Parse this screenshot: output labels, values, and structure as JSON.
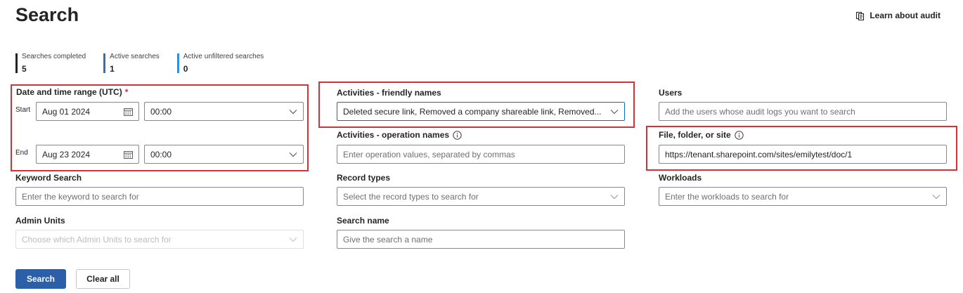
{
  "header": {
    "title": "Search",
    "learn_link": "Learn about audit",
    "learn_icon": "book-icon"
  },
  "stats": [
    {
      "label": "Searches completed",
      "value": "5",
      "color": "#242424"
    },
    {
      "label": "Active searches",
      "value": "1",
      "color": "#3a6ea8"
    },
    {
      "label": "Active unfiltered searches",
      "value": "0",
      "color": "#2f8fe0"
    }
  ],
  "date_range": {
    "label": "Date and time range (UTC)",
    "required_mark": "*",
    "start_label": "Start",
    "start_date": "Aug 01 2024",
    "start_time": "00:00",
    "end_label": "End",
    "end_date": "Aug 23 2024",
    "end_time": "00:00"
  },
  "keyword_search": {
    "label": "Keyword Search",
    "placeholder": "Enter the keyword to search for"
  },
  "admin_units": {
    "label": "Admin Units",
    "placeholder": "Choose which Admin Units to search for"
  },
  "activities_friendly": {
    "label": "Activities - friendly names",
    "value": "Deleted secure link, Removed a company shareable link, Removed..."
  },
  "activities_operation": {
    "label": "Activities - operation names",
    "placeholder": "Enter operation values, separated by commas"
  },
  "record_types": {
    "label": "Record types",
    "placeholder": "Select the record types to search for"
  },
  "search_name": {
    "label": "Search name",
    "placeholder": "Give the search a name"
  },
  "users": {
    "label": "Users",
    "placeholder": "Add the users whose audit logs you want to search"
  },
  "file_folder_site": {
    "label": "File, folder, or site",
    "value": "https://tenant.sharepoint.com/sites/emilytest/doc/1"
  },
  "workloads": {
    "label": "Workloads",
    "placeholder": "Enter the workloads to search for"
  },
  "buttons": {
    "search": "Search",
    "clear_all": "Clear all"
  },
  "colors": {
    "highlight": "#d13438",
    "primary": "#2b5fa7",
    "required": "#c4314b"
  }
}
